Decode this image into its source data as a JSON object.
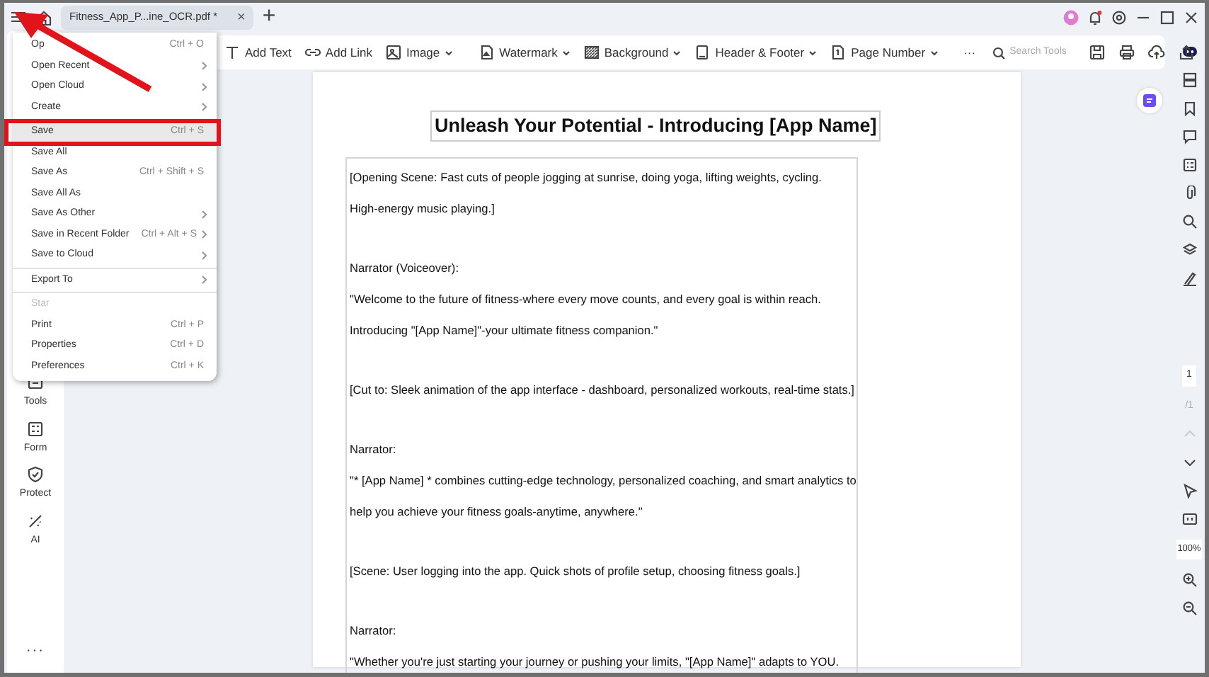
{
  "title_bar": {
    "tab": {
      "label": "Fitness_App_P...ine_OCR.pdf *",
      "close": "×",
      "selected": true
    },
    "new_tab": "+"
  },
  "toolbar": {
    "tools": [
      {
        "label": "Add Text",
        "dropdown": false
      },
      {
        "label": "Add Link",
        "dropdown": false
      },
      {
        "label": "Image",
        "dropdown": true
      },
      {
        "label": "Watermark",
        "dropdown": true
      },
      {
        "label": "Background",
        "dropdown": true
      },
      {
        "label": "Header & Footer",
        "dropdown": true
      },
      {
        "label": "Page Number",
        "dropdown": true
      }
    ],
    "more": "···",
    "search": {
      "placeholder": "Search Tools"
    }
  },
  "file_menu": {
    "items": [
      {
        "kind": "item",
        "label": "Op",
        "shortcut": "Ctrl + O",
        "submenu": false,
        "disabled": false,
        "selected": false
      },
      {
        "kind": "item",
        "label": "Open Recent",
        "submenu": true,
        "disabled": false,
        "selected": false
      },
      {
        "kind": "item",
        "label": "Open Cloud",
        "submenu": true,
        "disabled": false,
        "selected": false
      },
      {
        "kind": "item",
        "label": "Create",
        "submenu": true,
        "disabled": false,
        "selected": false
      },
      {
        "kind": "divider"
      },
      {
        "kind": "item",
        "label": "Save",
        "shortcut": "Ctrl + S",
        "submenu": false,
        "disabled": false,
        "selected": true
      },
      {
        "kind": "item",
        "label": "Save All",
        "submenu": false,
        "disabled": false,
        "selected": false
      },
      {
        "kind": "item",
        "label": "Save As",
        "shortcut": "Ctrl + Shift + S",
        "submenu": false,
        "disabled": false,
        "selected": false
      },
      {
        "kind": "item",
        "label": "Save All As",
        "submenu": false,
        "disabled": false,
        "selected": false
      },
      {
        "kind": "item",
        "label": "Save As Other",
        "submenu": true,
        "disabled": false,
        "selected": false
      },
      {
        "kind": "item",
        "label": "Save in Recent Folder",
        "shortcut": "Ctrl + Alt + S",
        "submenu": true,
        "disabled": false,
        "selected": false
      },
      {
        "kind": "item",
        "label": "Save to Cloud",
        "submenu": true,
        "disabled": false,
        "selected": false
      },
      {
        "kind": "divider"
      },
      {
        "kind": "item",
        "label": "Export To",
        "submenu": true,
        "disabled": false,
        "selected": false
      },
      {
        "kind": "divider"
      },
      {
        "kind": "item",
        "label": "Star",
        "submenu": false,
        "disabled": true,
        "selected": false
      },
      {
        "kind": "item",
        "label": "Print",
        "shortcut": "Ctrl + P",
        "submenu": false,
        "disabled": false,
        "selected": false
      },
      {
        "kind": "item",
        "label": "Properties",
        "shortcut": "Ctrl + D",
        "submenu": false,
        "disabled": false,
        "selected": false
      },
      {
        "kind": "item",
        "label": "Preferences",
        "shortcut": "Ctrl + K",
        "submenu": false,
        "disabled": false,
        "selected": false
      }
    ]
  },
  "sidebar": {
    "items": [
      {
        "label": "Tools"
      },
      {
        "label": "Form"
      },
      {
        "label": "Protect"
      },
      {
        "label": "AI"
      }
    ],
    "more": "···"
  },
  "document": {
    "title": "Unleash Your Potential - Introducing [App Name]",
    "paragraphs": [
      [
        "[Opening Scene: Fast cuts of people jogging at sunrise, doing yoga, lifting weights, cycling.",
        "High-energy music playing.]"
      ],
      [
        "Narrator (Voiceover):",
        "\"Welcome to the future of fitness-where every move counts, and every goal is within reach.",
        "Introducing \"[App Name]\"-your ultimate fitness companion.\""
      ],
      [
        "[Cut to: Sleek animation of the app interface - dashboard, personalized workouts, real-time stats.]"
      ],
      [
        "Narrator:",
        "\"* [App Name] * combines cutting-edge technology, personalized coaching, and smart analytics to",
        "help you achieve your fitness goals-anytime, anywhere.\""
      ],
      [
        "[Scene: User logging into the app. Quick shots of profile setup, choosing fitness goals.]"
      ],
      [
        "Narrator:",
        "\"Whether you're just starting your journey or pushing your limits, \"[App Name]\" adapts to YOU."
      ]
    ]
  },
  "page_nav": {
    "current": "1",
    "total": "/1"
  },
  "zoom": "100%"
}
